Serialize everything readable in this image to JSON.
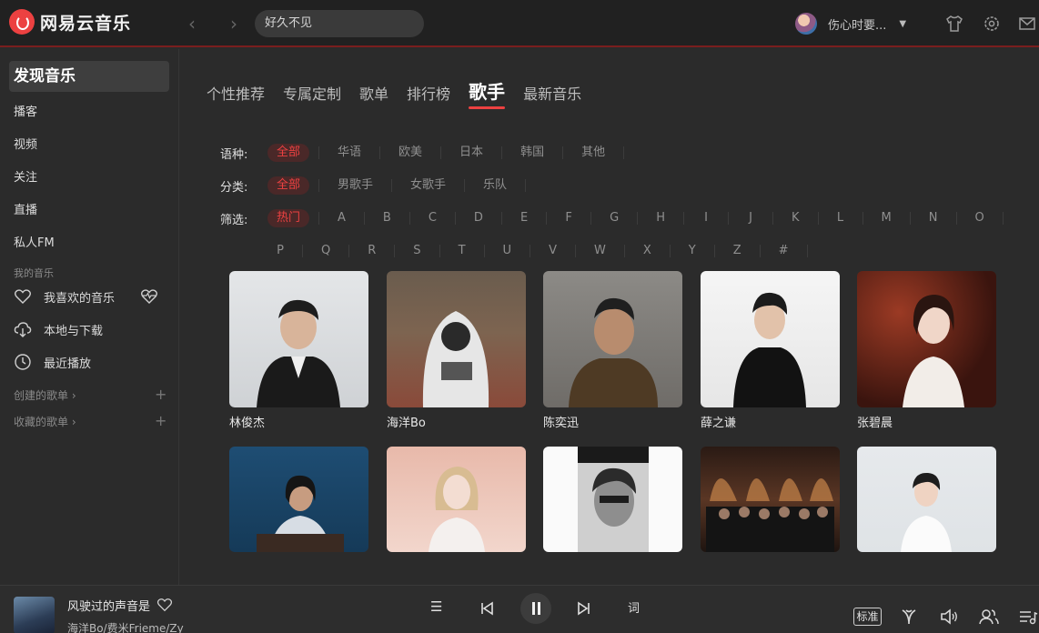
{
  "app": {
    "name": "网易云音乐"
  },
  "search": {
    "value": "好久不见"
  },
  "user": {
    "name": "伤心时要..."
  },
  "sidebar": {
    "active": "发现音乐",
    "items": [
      "播客",
      "视频",
      "关注",
      "直播",
      "私人FM"
    ],
    "my_music_label": "我的音乐",
    "my_music": [
      {
        "label": "我喜欢的音乐",
        "icon": "heart-icon"
      },
      {
        "label": "本地与下载",
        "icon": "cloud-download-icon"
      },
      {
        "label": "最近播放",
        "icon": "clock-icon"
      }
    ],
    "created_playlists": "创建的歌单",
    "collected_playlists": "收藏的歌单"
  },
  "tabs": [
    "个性推荐",
    "专属定制",
    "歌单",
    "排行榜",
    "歌手",
    "最新音乐"
  ],
  "active_tab": "歌手",
  "filters": {
    "language": {
      "label": "语种:",
      "options": [
        "全部",
        "华语",
        "欧美",
        "日本",
        "韩国",
        "其他"
      ],
      "selected": "全部"
    },
    "category": {
      "label": "分类:",
      "options": [
        "全部",
        "男歌手",
        "女歌手",
        "乐队"
      ],
      "selected": "全部"
    },
    "index": {
      "label": "筛选:",
      "row1": [
        "热门",
        "A",
        "B",
        "C",
        "D",
        "E",
        "F",
        "G",
        "H",
        "I",
        "J",
        "K",
        "L",
        "M",
        "N",
        "O"
      ],
      "row2": [
        "P",
        "Q",
        "R",
        "S",
        "T",
        "U",
        "V",
        "W",
        "X",
        "Y",
        "Z",
        "#"
      ],
      "selected": "热门"
    }
  },
  "artists": [
    {
      "name": "林俊杰"
    },
    {
      "name": "海洋Bo"
    },
    {
      "name": "陈奕迅"
    },
    {
      "name": "薛之谦"
    },
    {
      "name": "张碧晨"
    },
    {
      "name": ""
    },
    {
      "name": ""
    },
    {
      "name": ""
    },
    {
      "name": ""
    },
    {
      "name": ""
    }
  ],
  "player": {
    "title": "风驶过的声音是",
    "artist": "海洋Bo/费米Frieme/Zy",
    "quality": "标准",
    "lyric_label": "词"
  },
  "colors": {
    "accent": "#ec4141",
    "background": "#2b2b2b",
    "topbar": "#212121"
  }
}
